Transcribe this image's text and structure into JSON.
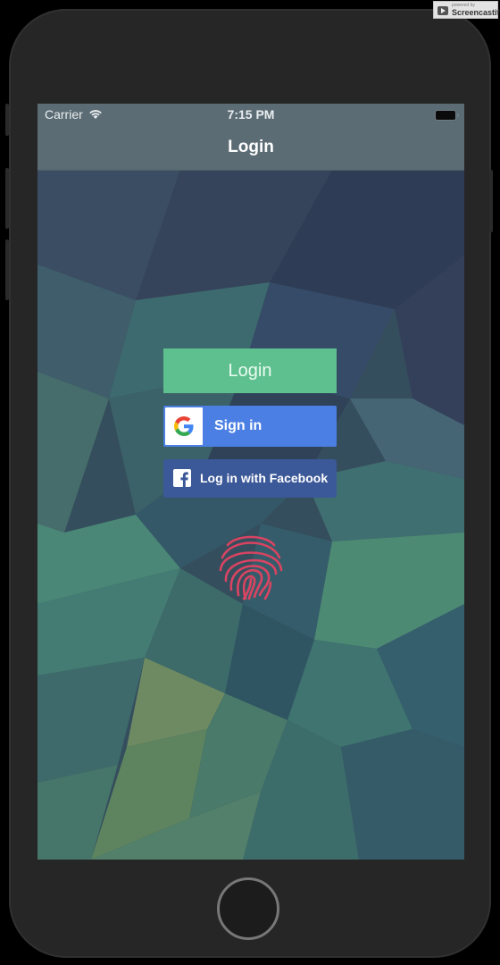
{
  "status_bar": {
    "carrier": "Carrier",
    "time": "7:15 PM",
    "wifi_icon": "wifi-icon",
    "battery_icon": "battery-icon"
  },
  "nav": {
    "title": "Login"
  },
  "buttons": {
    "login_label": "Login",
    "google_label": "Sign in",
    "facebook_label": "Log in with Facebook"
  },
  "icons": {
    "google": "google-g-icon",
    "facebook": "facebook-f-icon",
    "fingerprint": "fingerprint-icon"
  },
  "watermark": {
    "small_text": "powered by",
    "brand": "Screencastify"
  },
  "colors": {
    "login_button": "#5fc08f",
    "google_button": "#4b7fe3",
    "facebook_button": "#3b5898",
    "fingerprint": "#d94462",
    "nav_bar": "#5c6c74"
  }
}
